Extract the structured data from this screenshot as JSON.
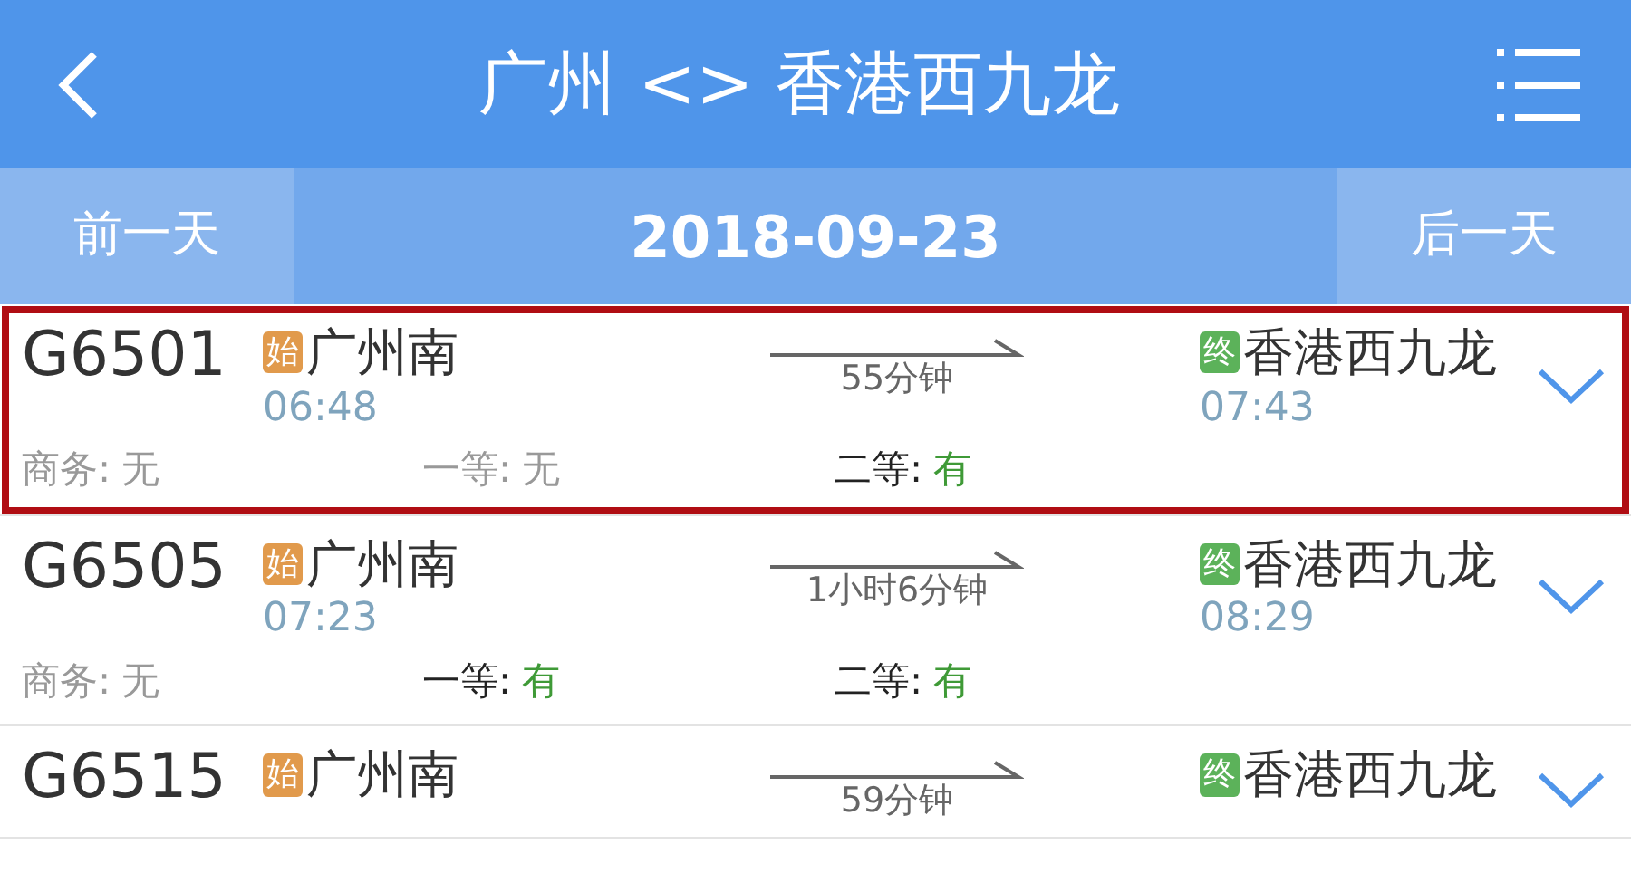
{
  "header": {
    "title": "广州 <> 香港西九龙"
  },
  "date_bar": {
    "prev": "前一天",
    "date": "2018-09-23",
    "next": "后一天"
  },
  "trains": [
    {
      "number": "G6501",
      "highlighted": true,
      "origin": {
        "badge": "始",
        "station": "广州南",
        "time": "06:48"
      },
      "duration": "55分钟",
      "destination": {
        "badge": "终",
        "station": "香港西九龙",
        "time": "07:43"
      },
      "seats": [
        {
          "label": "商务:",
          "value": "无",
          "available": false
        },
        {
          "label": "一等:",
          "value": "无",
          "available": false
        },
        {
          "label": "二等:",
          "value": "有",
          "available": true
        }
      ]
    },
    {
      "number": "G6505",
      "highlighted": false,
      "origin": {
        "badge": "始",
        "station": "广州南",
        "time": "07:23"
      },
      "duration": "1小时6分钟",
      "destination": {
        "badge": "终",
        "station": "香港西九龙",
        "time": "08:29"
      },
      "seats": [
        {
          "label": "商务:",
          "value": "无",
          "available": false
        },
        {
          "label": "一等:",
          "value": "有",
          "available": true
        },
        {
          "label": "二等:",
          "value": "有",
          "available": true
        }
      ]
    },
    {
      "number": "G6515",
      "highlighted": false,
      "origin": {
        "badge": "始",
        "station": "广州南"
      },
      "duration": "59分钟",
      "destination": {
        "badge": "终",
        "station": "香港西九龙"
      }
    }
  ]
}
